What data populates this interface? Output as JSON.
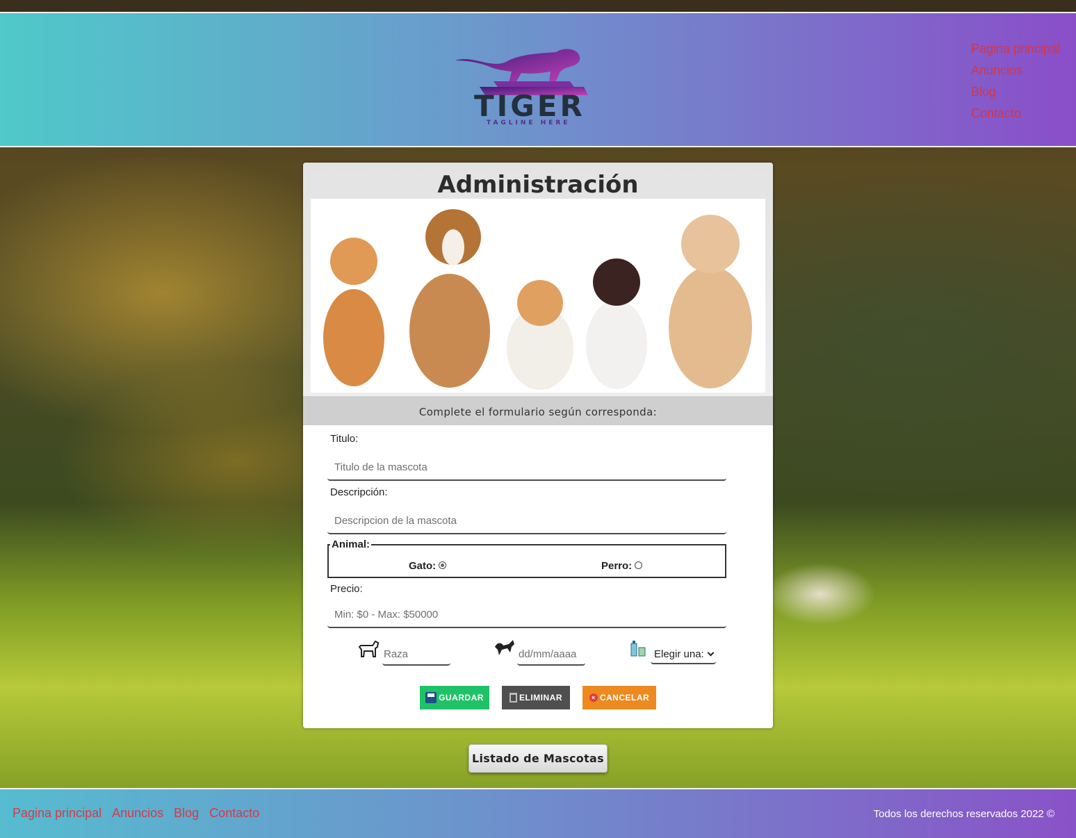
{
  "header": {
    "logo_text": "TIGER",
    "logo_tagline": "TAGLINE HERE",
    "nav": [
      "Pagina principal",
      "Anuncios",
      "Blog",
      "Contacto"
    ]
  },
  "panel": {
    "title": "Administración",
    "subtitle": "Complete el formulario según corresponda:",
    "titulo_label": "Titulo:",
    "titulo_placeholder": "Titulo de la mascota",
    "descripcion_label": "Descripción:",
    "descripcion_placeholder": "Descripcion de la mascota",
    "animal_legend": "Animal:",
    "animal_options": [
      {
        "label": "Gato:",
        "selected": true
      },
      {
        "label": "Perro:",
        "selected": false
      }
    ],
    "precio_label": "Precio:",
    "precio_placeholder": "Min: $0 - Max: $50000",
    "raza_placeholder": "Raza",
    "fecha_placeholder": "dd/mm/aaaa",
    "select_value": "Elegir una:",
    "buttons": {
      "save": "GUARDAR",
      "delete": "ELIMINAR",
      "cancel": "CANCELAR"
    },
    "icons": {
      "raza": "dog-icon",
      "fecha": "tiger-icon",
      "select": "medicine-icon"
    }
  },
  "list_button": "Listado de Mascotas",
  "footer": {
    "nav": [
      "Pagina principal",
      "Anuncios",
      "Blog",
      "Contacto"
    ],
    "copyright": "Todos los derechos reservados 2022 ©"
  },
  "colors": {
    "nav_link": "#d0384a",
    "save": "#20c268",
    "delete": "#4f4f4f",
    "cancel": "#ec8a20"
  }
}
